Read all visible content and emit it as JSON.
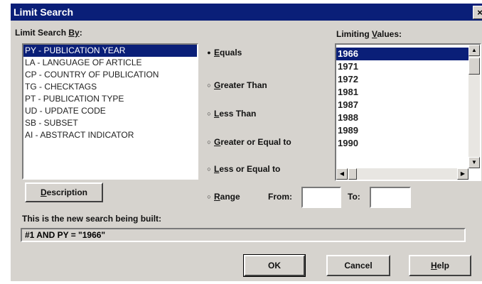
{
  "dialog": {
    "title": "Limit Search",
    "close_glyph": "×"
  },
  "left": {
    "label_prefix": "Limit Search ",
    "label_accel": "By",
    "label_suffix": ":",
    "items": [
      {
        "label": "PY - PUBLICATION YEAR",
        "selected": true
      },
      {
        "label": "LA - LANGUAGE OF ARTICLE",
        "selected": false
      },
      {
        "label": "CP - COUNTRY OF PUBLICATION",
        "selected": false
      },
      {
        "label": "TG - CHECKTAGS",
        "selected": false
      },
      {
        "label": "PT - PUBLICATION TYPE",
        "selected": false
      },
      {
        "label": "UD - UPDATE CODE",
        "selected": false
      },
      {
        "label": "SB - SUBSET",
        "selected": false
      },
      {
        "label": "AI - ABSTRACT INDICATOR",
        "selected": false
      }
    ]
  },
  "operators": {
    "equals": {
      "accel": "E",
      "rest": "quals",
      "checked": true
    },
    "greater": {
      "accel": "G",
      "rest": "reater Than",
      "checked": false
    },
    "less": {
      "accel": "L",
      "rest": "ess Than",
      "checked": false
    },
    "greater_eq": {
      "accel": "G",
      "rest": "reater or Equal to",
      "checked": false
    },
    "less_eq": {
      "accel": "L",
      "rest": "ess or Equal to",
      "checked": false
    },
    "range": {
      "accel": "R",
      "rest": "ange",
      "checked": false
    },
    "from_label": "From:",
    "from_value": "",
    "to_label": "To:",
    "to_value": ""
  },
  "values": {
    "label_prefix": "Limiting ",
    "label_accel": "V",
    "label_suffix": "alues:",
    "items": [
      {
        "label": "1966",
        "selected": true
      },
      {
        "label": "1971",
        "selected": false
      },
      {
        "label": "1972",
        "selected": false
      },
      {
        "label": "1981",
        "selected": false
      },
      {
        "label": "1987",
        "selected": false
      },
      {
        "label": "1988",
        "selected": false
      },
      {
        "label": "1989",
        "selected": false
      },
      {
        "label": "1990",
        "selected": false
      }
    ]
  },
  "description_button": {
    "accel": "D",
    "rest": "escription"
  },
  "search": {
    "label": "This is the new search being built:",
    "value": "#1 AND PY = \"1966\""
  },
  "buttons": {
    "ok": "OK",
    "cancel": "Cancel",
    "help_accel": "H",
    "help_rest": "elp"
  },
  "colors": {
    "titlebar": "#0a1f78",
    "selection": "#0a1f78",
    "face": "#d6d3ce"
  }
}
